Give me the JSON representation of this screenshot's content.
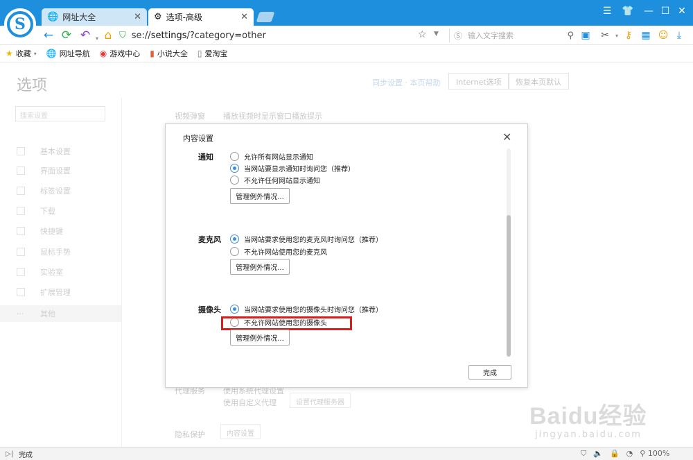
{
  "tabs": [
    {
      "label": "网址大全",
      "icon": "globe-icon",
      "active": false
    },
    {
      "label": "选项-高级",
      "icon": "gear-icon",
      "active": true
    }
  ],
  "address_bar": {
    "url_prefix": "se://",
    "url_host": "settings",
    "url_rest": "/?category=other",
    "search_placeholder": "输入文字搜索"
  },
  "bookmarks": [
    {
      "label": "收藏",
      "icon": "star-icon"
    },
    {
      "label": "网址导航",
      "icon": "globe-icon"
    },
    {
      "label": "游戏中心",
      "icon": "game-icon"
    },
    {
      "label": "小说大全",
      "icon": "book-icon"
    },
    {
      "label": "爱淘宝",
      "icon": "page-icon"
    }
  ],
  "settings_page": {
    "title": "选项",
    "header_links": "同步设置 · 本页帮助",
    "internet_options_button": "Internet选项",
    "restore_defaults_button": "恢复本页默认",
    "side_search_placeholder": "搜索设置",
    "sidebar": [
      "基本设置",
      "界面设置",
      "标签设置",
      "下载",
      "快捷键",
      "鼠标手势",
      "实验室",
      "扩展管理",
      "其他"
    ],
    "bg_video_label": "视频弹窗",
    "bg_video_option": "播放视频时显示窗口播放提示",
    "bg_proxy_label": "代理服务",
    "bg_proxy_option1": "使用系统代理设置",
    "bg_proxy_option2": "使用自定义代理",
    "bg_proxy_button": "设置代理服务器",
    "bg_privacy_label": "隐私保护",
    "bg_content_button": "内容设置"
  },
  "dialog": {
    "title": "内容设置",
    "close_symbol": "✕",
    "sections": [
      {
        "label": "通知",
        "options": [
          "允许所有网站显示通知",
          "当网站要显示通知时询问您（推荐）",
          "不允许任何网站显示通知"
        ],
        "selected_index": 1,
        "button": "管理例外情况..."
      },
      {
        "label": "麦克风",
        "options": [
          "当网站要求使用您的麦克风时询问您（推荐）",
          "不允许网站使用您的麦克风"
        ],
        "selected_index": 0,
        "button": "管理例外情况..."
      },
      {
        "label": "摄像头",
        "options": [
          "当网站要求使用您的摄像头时询问您（推荐）",
          "不允许网站使用您的摄像头"
        ],
        "selected_index": 0,
        "button": "管理例外情况..."
      }
    ],
    "done_button": "完成"
  },
  "statusbar": {
    "text": "完成",
    "zoom": "100%"
  },
  "watermark": {
    "main": "Baidu经验",
    "sub": "jingyan.baidu.com"
  },
  "colors": {
    "titlebar": "#1e8fdc",
    "highlight": "#d91e1e",
    "radio_checked": "#3b8ede"
  }
}
